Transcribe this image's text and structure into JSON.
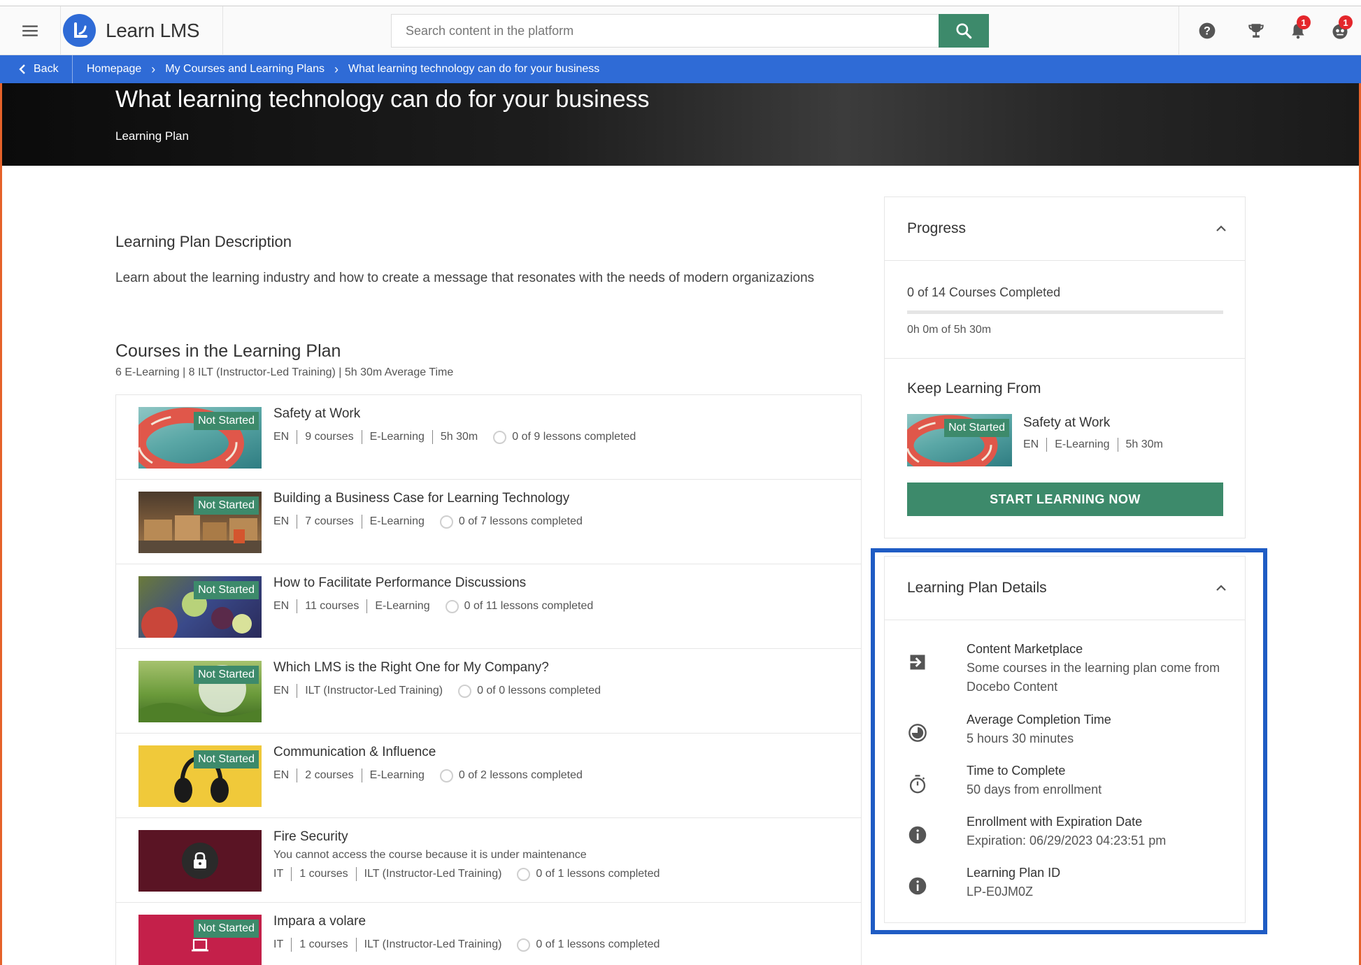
{
  "app": {
    "name": "Learn LMS"
  },
  "search": {
    "placeholder": "Search content in the platform"
  },
  "header": {
    "notifications_badge": "1",
    "profile_badge": "1"
  },
  "breadcrumb": {
    "back_label": "Back",
    "items": [
      "Homepage",
      "My Courses and Learning Plans",
      "What learning technology can do for your business"
    ]
  },
  "hero": {
    "title": "What learning technology can do for your business",
    "subtitle": "Learning Plan"
  },
  "description": {
    "heading": "Learning Plan Description",
    "text": "Learn about the learning industry and how to create a message that resonates with the needs of modern organizazions"
  },
  "courses": {
    "heading": "Courses in the Learning Plan",
    "summary": "6 E-Learning | 8 ILT (Instructor-Led Training) | 5h 30m Average Time",
    "items": [
      {
        "title": "Safety at Work",
        "status": "Not Started",
        "lang": "EN",
        "count": "9 courses",
        "type": "E-Learning",
        "duration": "5h 30m",
        "lessons": "0 of 9 lessons completed",
        "thumb": "lifebuoy"
      },
      {
        "title": "Building a Business Case for Learning Technology",
        "status": "Not Started",
        "lang": "EN",
        "count": "7 courses",
        "type": "E-Learning",
        "lessons": "0 of 7 lessons completed",
        "thumb": "warehouse"
      },
      {
        "title": "How to Facilitate Performance Discussions",
        "status": "Not Started",
        "lang": "EN",
        "count": "11 courses",
        "type": "E-Learning",
        "lessons": "0 of 11 lessons completed",
        "thumb": "fruit"
      },
      {
        "title": "Which LMS is the Right One for My Company?",
        "status": "Not Started",
        "lang": "EN",
        "type": "ILT (Instructor-Led Training)",
        "lessons": "0 of 0 lessons completed",
        "thumb": "globe"
      },
      {
        "title": "Communication & Influence",
        "status": "Not Started",
        "lang": "EN",
        "count": "2 courses",
        "type": "E-Learning",
        "lessons": "0 of 2 lessons completed",
        "thumb": "headphones"
      },
      {
        "title": "Fire Security",
        "warning": "You cannot access the course because it is under maintenance",
        "lang": "IT",
        "count": "1 courses",
        "type": "ILT (Instructor-Led Training)",
        "lessons": "0 of 1 lessons completed",
        "thumb": "locked"
      },
      {
        "title": "Impara a volare",
        "status": "Not Started",
        "lang": "IT",
        "count": "1 courses",
        "type": "ILT (Instructor-Led Training)",
        "lessons": "0 of 1 lessons completed",
        "thumb": "classroom"
      }
    ]
  },
  "progress": {
    "heading": "Progress",
    "completed_text": "0 of 14 Courses Completed",
    "fraction": 0,
    "time_text": "0h 0m of 5h 30m"
  },
  "keep_learning": {
    "heading": "Keep Learning From",
    "status": "Not Started",
    "course_title": "Safety at Work",
    "lang": "EN",
    "type": "E-Learning",
    "duration": "5h 30m",
    "button_label": "START LEARNING NOW"
  },
  "details": {
    "heading": "Learning Plan Details",
    "items": [
      {
        "icon": "arrow-into-box-icon",
        "label": "Content Marketplace",
        "value": "Some courses in the learning plan come from Docebo Content"
      },
      {
        "icon": "clock-half-icon",
        "label": "Average Completion Time",
        "value": "5 hours 30 minutes"
      },
      {
        "icon": "stopwatch-icon",
        "label": "Time to Complete",
        "value": "50 days from enrollment"
      },
      {
        "icon": "info-icon",
        "label": "Enrollment with Expiration Date",
        "value": "Expiration: 06/29/2023 04:23:51 pm"
      },
      {
        "icon": "info-icon",
        "label": "Learning Plan ID",
        "value": "LP-E0JM0Z"
      }
    ]
  },
  "colors": {
    "primary": "#2f6bd6",
    "accent_green": "#3d8a6b",
    "highlight": "#1f5cc4",
    "badge": "#e4262b"
  }
}
